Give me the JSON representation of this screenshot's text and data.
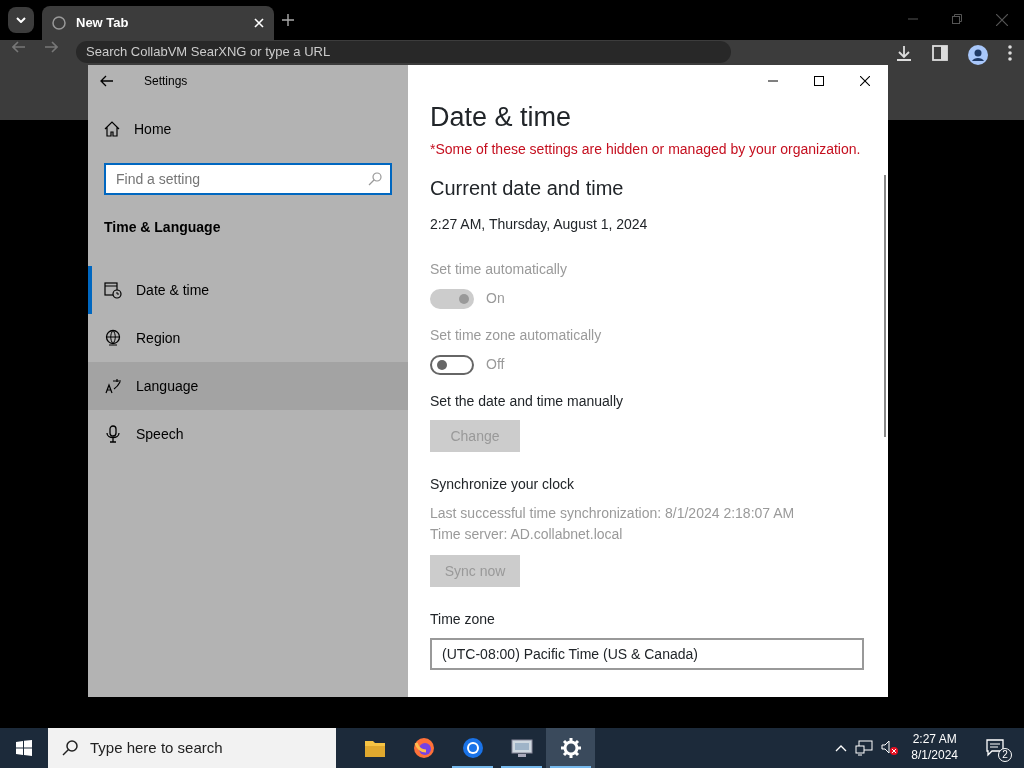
{
  "browser": {
    "tab_title": "New Tab",
    "address_placeholder": "Search CollabVM SearXNG or type a URL"
  },
  "settings_window": {
    "title": "Settings",
    "sidebar": {
      "home": "Home",
      "search_placeholder": "Find a setting",
      "section": "Time & Language",
      "items": [
        {
          "kind": "clock",
          "label": "Date & time",
          "selected": true,
          "hovered": false
        },
        {
          "kind": "globe",
          "label": "Region",
          "selected": false,
          "hovered": false
        },
        {
          "kind": "language",
          "label": "Language",
          "selected": false,
          "hovered": true
        },
        {
          "kind": "mic",
          "label": "Speech",
          "selected": false,
          "hovered": false
        }
      ]
    },
    "main": {
      "heading": "Date & time",
      "notice": "*Some of these settings are hidden or managed by your organization.",
      "section_title": "Current date and time",
      "current": "2:27 AM, Thursday, August 1, 2024",
      "toggles": [
        {
          "label": "Set time automatically",
          "state_text": "On",
          "on": true,
          "disabled": true
        },
        {
          "label": "Set time zone automatically",
          "state_text": "Off",
          "on": false,
          "disabled": false
        }
      ],
      "manual": {
        "label": "Set the date and time manually",
        "button": "Change",
        "disabled": true
      },
      "sync": {
        "title": "Synchronize your clock",
        "last_sync": "Last successful time synchronization: 8/1/2024 2:18:07 AM",
        "server": "Time server: AD.collabnet.local",
        "button": "Sync now",
        "disabled": true
      },
      "time_zone": {
        "label": "Time zone",
        "value": "(UTC-08:00) Pacific Time (US & Canada)"
      }
    }
  },
  "taskbar": {
    "search_placeholder": "Type here to search",
    "apps": [
      {
        "kind": "folder",
        "open": false,
        "active": false
      },
      {
        "kind": "fox",
        "open": false,
        "active": false
      },
      {
        "kind": "chrome",
        "open": true,
        "active": false
      },
      {
        "kind": "monitor",
        "open": true,
        "active": false
      },
      {
        "kind": "gear",
        "open": true,
        "active": true
      }
    ],
    "time": "2:27 AM",
    "date": "8/1/2024",
    "notification_count": "2"
  }
}
